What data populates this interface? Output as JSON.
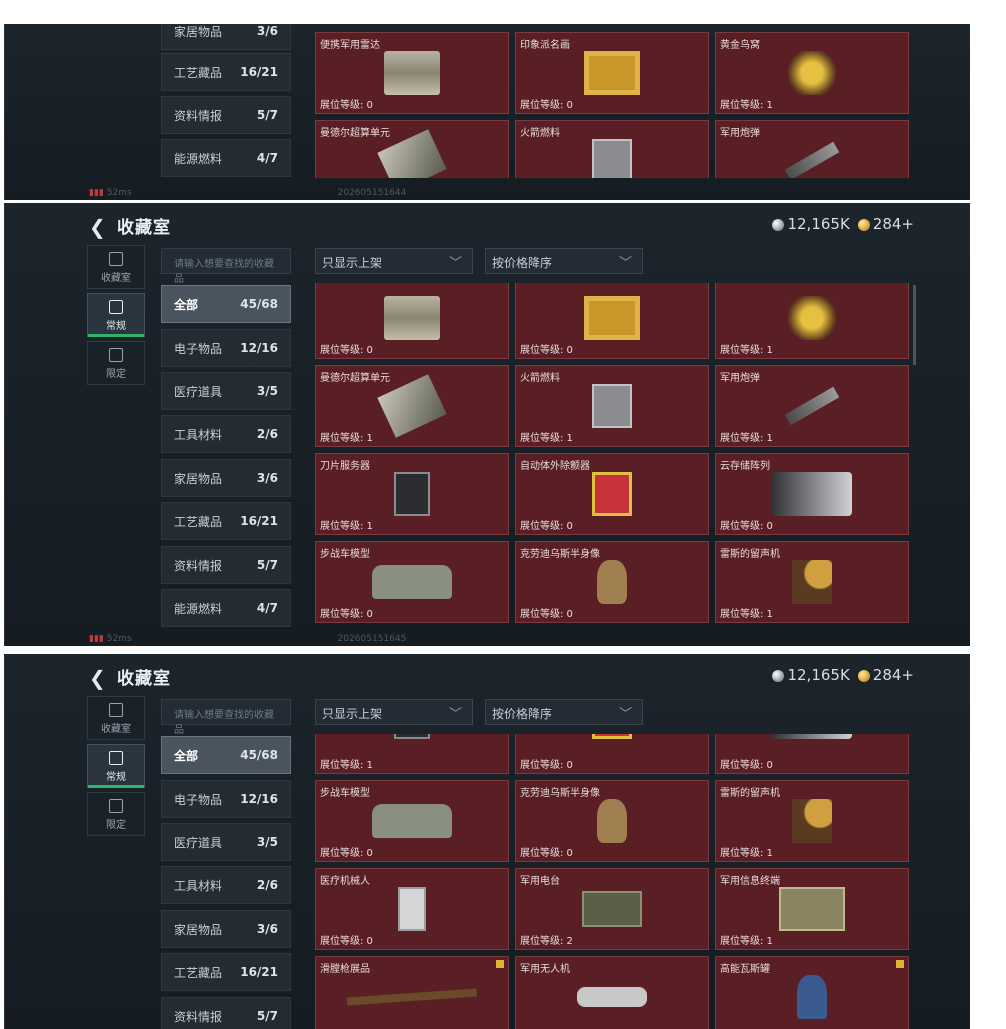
{
  "panel_top": {
    "categories": [
      {
        "label": "家居物品",
        "count": "3/6"
      },
      {
        "label": "工艺藏品",
        "count": "16/21"
      },
      {
        "label": "资料情报",
        "count": "5/7"
      },
      {
        "label": "能源燃料",
        "count": "4/7"
      }
    ],
    "cards": [
      {
        "name": "便携军用雷达",
        "level": "展位等级: 0",
        "icon": "radar-icon"
      },
      {
        "name": "印象派名画",
        "level": "展位等级: 0",
        "icon": "painting-icon"
      },
      {
        "name": "黄金鸟窝",
        "level": "展位等级: 1",
        "icon": "gold-nest-icon"
      },
      {
        "name": "曼德尔超算单元",
        "level": "",
        "icon": "chip-icon"
      },
      {
        "name": "火箭燃料",
        "level": "",
        "icon": "fuel-can-icon"
      },
      {
        "name": "军用炮弹",
        "level": "",
        "icon": "shell-icon"
      }
    ],
    "status": {
      "signal": "52ms",
      "id": "202605151644"
    }
  },
  "panel_mid": {
    "title": "收藏室",
    "currency_silver": "12,165K",
    "currency_gold": "284+",
    "sidebar": [
      {
        "label": "收藏室"
      },
      {
        "label": "常规"
      },
      {
        "label": "限定"
      }
    ],
    "search_placeholder": "请输入想要查找的收藏品",
    "filter": "只显示上架",
    "sort": "按价格降序",
    "categories": [
      {
        "label": "全部",
        "count": "45/68"
      },
      {
        "label": "电子物品",
        "count": "12/16"
      },
      {
        "label": "医疗道具",
        "count": "3/5"
      },
      {
        "label": "工具材料",
        "count": "2/6"
      },
      {
        "label": "家居物品",
        "count": "3/6"
      },
      {
        "label": "工艺藏品",
        "count": "16/21"
      },
      {
        "label": "资料情报",
        "count": "5/7"
      },
      {
        "label": "能源燃料",
        "count": "4/7"
      }
    ],
    "cards": [
      {
        "name": "",
        "level": "展位等级: 0",
        "icon": "radar-icon"
      },
      {
        "name": "",
        "level": "展位等级: 0",
        "icon": "painting-icon"
      },
      {
        "name": "",
        "level": "展位等级: 1",
        "icon": "gold-nest-icon"
      },
      {
        "name": "曼德尔超算单元",
        "level": "展位等级: 1",
        "icon": "chip-icon"
      },
      {
        "name": "火箭燃料",
        "level": "展位等级: 1",
        "icon": "fuel-can-icon"
      },
      {
        "name": "军用炮弹",
        "level": "展位等级: 1",
        "icon": "shell-icon"
      },
      {
        "name": "刀片服务器",
        "level": "展位等级: 1",
        "icon": "server-icon"
      },
      {
        "name": "自动体外除颤器",
        "level": "展位等级: 0",
        "icon": "aed-icon"
      },
      {
        "name": "云存储阵列",
        "level": "展位等级: 0",
        "icon": "storage-icon"
      },
      {
        "name": "步战车模型",
        "level": "展位等级: 0",
        "icon": "ifv-icon"
      },
      {
        "name": "克劳迪乌斯半身像",
        "level": "展位等级: 0",
        "icon": "bust-icon"
      },
      {
        "name": "雷斯的留声机",
        "level": "展位等级: 1",
        "icon": "phonograph-icon"
      }
    ],
    "status": {
      "signal": "52ms",
      "id": "202605151645"
    }
  },
  "panel_bot": {
    "title": "收藏室",
    "currency_silver": "12,165K",
    "currency_gold": "284+",
    "sidebar": [
      {
        "label": "收藏室"
      },
      {
        "label": "常规"
      },
      {
        "label": "限定"
      }
    ],
    "search_placeholder": "请输入想要查找的收藏品",
    "filter": "只显示上架",
    "sort": "按价格降序",
    "categories": [
      {
        "label": "全部",
        "count": "45/68"
      },
      {
        "label": "电子物品",
        "count": "12/16"
      },
      {
        "label": "医疗道具",
        "count": "3/5"
      },
      {
        "label": "工具材料",
        "count": "2/6"
      },
      {
        "label": "家居物品",
        "count": "3/6"
      },
      {
        "label": "工艺藏品",
        "count": "16/21"
      },
      {
        "label": "资料情报",
        "count": "5/7"
      }
    ],
    "cards": [
      {
        "name": "",
        "level": "展位等级: 1",
        "icon": "server-icon"
      },
      {
        "name": "",
        "level": "展位等级: 0",
        "icon": "aed-icon"
      },
      {
        "name": "",
        "level": "展位等级: 0",
        "icon": "storage-icon"
      },
      {
        "name": "步战车模型",
        "level": "展位等级: 0",
        "icon": "ifv-icon"
      },
      {
        "name": "克劳迪乌斯半身像",
        "level": "展位等级: 0",
        "icon": "bust-icon"
      },
      {
        "name": "雷斯的留声机",
        "level": "展位等级: 1",
        "icon": "phonograph-icon"
      },
      {
        "name": "医疗机械人",
        "level": "展位等级: 0",
        "icon": "robot-icon"
      },
      {
        "name": "军用电台",
        "level": "展位等级: 2",
        "icon": "radio-icon"
      },
      {
        "name": "军用信息终端",
        "level": "展位等级: 1",
        "icon": "terminal-icon"
      },
      {
        "name": "滑膛枪展品",
        "level": "",
        "icon": "musket-icon",
        "new": true
      },
      {
        "name": "军用无人机",
        "level": "",
        "icon": "drone-icon"
      },
      {
        "name": "高能瓦斯罐",
        "level": "",
        "icon": "gas-tank-icon",
        "new": true
      }
    ]
  },
  "colors": {
    "accent": "#2fb46b",
    "card": "#5a1f25",
    "active_cat": "#4a545e"
  }
}
